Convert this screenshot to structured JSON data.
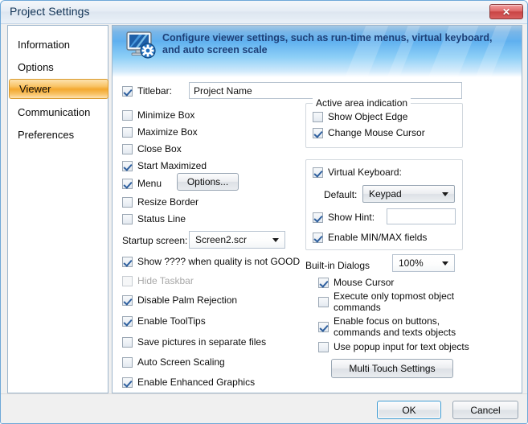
{
  "window": {
    "title": "Project Settings",
    "close_label": "✕"
  },
  "sidebar": {
    "items": [
      {
        "label": "Information",
        "selected": false
      },
      {
        "label": "Options",
        "selected": false
      },
      {
        "label": "Viewer",
        "selected": true
      },
      {
        "label": "Communication",
        "selected": false
      },
      {
        "label": "Preferences",
        "selected": false
      }
    ]
  },
  "banner": {
    "icon": "monitor-gear-icon",
    "text": "Configure viewer settings, such as run-time menus, virtual keyboard, and auto screen scale"
  },
  "viewer": {
    "titlebar": {
      "checkbox_label": "Titlebar:",
      "checked": true,
      "value": "Project Name",
      "placeholder": ""
    },
    "window_options": [
      {
        "label": "Minimize Box",
        "checked": false,
        "disabled": false
      },
      {
        "label": "Maximize Box",
        "checked": false,
        "disabled": false
      },
      {
        "label": "Close Box",
        "checked": false,
        "disabled": false
      },
      {
        "label": "Start Maximized",
        "checked": true,
        "disabled": false
      },
      {
        "label": "Menu",
        "checked": true,
        "disabled": false
      },
      {
        "label": "Resize Border",
        "checked": false,
        "disabled": false
      },
      {
        "label": "Status Line",
        "checked": false,
        "disabled": false
      }
    ],
    "menu_options_button": "Options...",
    "startup_screen": {
      "label": "Startup screen:",
      "value": "Screen2.scr"
    },
    "display_options": [
      {
        "label": "Show ???? when quality is not GOOD",
        "checked": true,
        "disabled": false
      },
      {
        "label": "Hide Taskbar",
        "checked": false,
        "disabled": true
      },
      {
        "label": "Disable Palm Rejection",
        "checked": true,
        "disabled": false
      },
      {
        "label": "Enable ToolTips",
        "checked": true,
        "disabled": false
      },
      {
        "label": "Save pictures in separate files",
        "checked": false,
        "disabled": false
      },
      {
        "label": "Auto Screen Scaling",
        "checked": false,
        "disabled": false
      },
      {
        "label": "Enable Enhanced Graphics",
        "checked": true,
        "disabled": false
      }
    ],
    "active_area": {
      "title": "Active area indication",
      "items": [
        {
          "label": "Show Object Edge",
          "checked": false
        },
        {
          "label": "Change Mouse Cursor",
          "checked": true
        }
      ]
    },
    "virtual_keyboard": {
      "checkbox_label": "Virtual Keyboard:",
      "checked": true,
      "default_label": "Default:",
      "default_value": "Keypad",
      "show_hint_label": "Show Hint:",
      "show_hint_checked": true,
      "show_hint_value": "",
      "minmax_label": "Enable MIN/MAX fields",
      "minmax_checked": true
    },
    "builtin_dialogs": {
      "label": "Built-in Dialogs",
      "scale_value": "100%",
      "items": [
        {
          "label": "Mouse Cursor",
          "checked": true
        },
        {
          "label": "Execute only topmost object commands",
          "checked": false
        },
        {
          "label": "Enable focus on buttons, commands and texts objects",
          "checked": true
        },
        {
          "label": "Use popup input for text objects",
          "checked": false
        }
      ],
      "multi_touch_button": "Multi Touch Settings"
    }
  },
  "footer": {
    "ok_label": "OK",
    "cancel_label": "Cancel"
  }
}
